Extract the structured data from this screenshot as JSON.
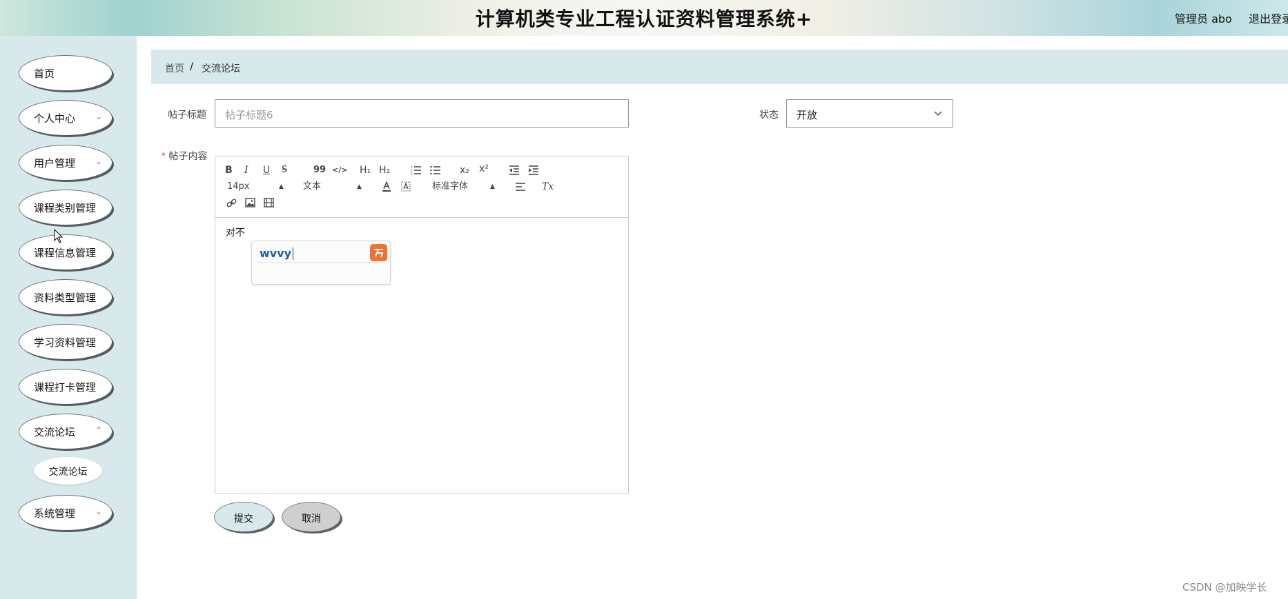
{
  "header": {
    "title": "计算机类专业工程认证资料管理系统+",
    "admin": "管理员 abo",
    "logout": "退出登录"
  },
  "sidebar": {
    "items": [
      {
        "label": "首页"
      },
      {
        "label": "个人中心"
      },
      {
        "label": "用户管理"
      },
      {
        "label": "课程类别管理"
      },
      {
        "label": "课程信息管理"
      },
      {
        "label": "资料类型管理"
      },
      {
        "label": "学习资料管理"
      },
      {
        "label": "课程打卡管理"
      },
      {
        "label": "交流论坛"
      },
      {
        "label": "系统管理"
      }
    ],
    "sub_item": "交流论坛"
  },
  "breadcrumb": {
    "home": "首页",
    "separator": "/",
    "current": "交流论坛"
  },
  "form": {
    "title_label": "帖子标题",
    "title_value": "帖子标题6",
    "status_label": "状态",
    "status_value": "开放",
    "required_mark": "*",
    "content_label": "帖子内容",
    "content_text": "对不",
    "ime_text": "wvvy"
  },
  "editor_toolbar": {
    "bold": "B",
    "italic": "I",
    "underline": "U",
    "strike": "S",
    "quote": "99",
    "code": "</>",
    "h1": "H₁",
    "h2": "H₂",
    "sub": "x₂",
    "sup": "x²",
    "size": "14px",
    "block": "文本",
    "font": "标准字体",
    "clear": "Tx"
  },
  "buttons": {
    "submit": "提交",
    "cancel": "取消"
  },
  "watermark": "CSDN @加映学长",
  "colors": {
    "sidebar_bg": "#d8e9ec",
    "breadcrumb_bg": "#d8e9ec",
    "submit_bg": "#d8e9ec",
    "cancel_bg": "#cfcfcf",
    "ime_logo": "#f07133"
  }
}
